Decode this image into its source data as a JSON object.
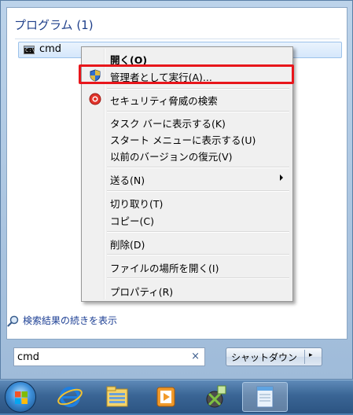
{
  "start_menu": {
    "section_title": "プログラム (1)",
    "result": {
      "label": "cmd",
      "icon": "cmd-console-icon"
    },
    "see_more_label": "検索結果の続きを表示",
    "search": {
      "value": "cmd",
      "clear_symbol": "×"
    },
    "shutdown": {
      "label": "シャットダウン",
      "arrow": "▸"
    }
  },
  "context_menu": {
    "items": [
      {
        "label": "開く(O)",
        "bold": true
      },
      {
        "label": "管理者として実行(A)...",
        "icon": "uac-shield-icon",
        "highlighted": true
      },
      {
        "label": "セキュリティ脅威の検索",
        "icon": "security-scan-icon"
      },
      {
        "label": "タスク バーに表示する(K)"
      },
      {
        "label": "スタート メニューに表示する(U)"
      },
      {
        "label": "以前のバージョンの復元(V)"
      },
      {
        "label": "送る(N)",
        "submenu": true
      },
      {
        "label": "切り取り(T)"
      },
      {
        "label": "コピー(C)"
      },
      {
        "label": "削除(D)"
      },
      {
        "label": "ファイルの場所を開く(I)"
      },
      {
        "label": "プロパティ(R)"
      }
    ],
    "highlight_color": "#e8161b"
  },
  "taskbar": {
    "items": [
      "start-orb-icon",
      "internet-explorer-icon",
      "file-explorer-icon",
      "media-player-icon",
      "xbox-app-icon",
      "notepad-icon"
    ]
  }
}
